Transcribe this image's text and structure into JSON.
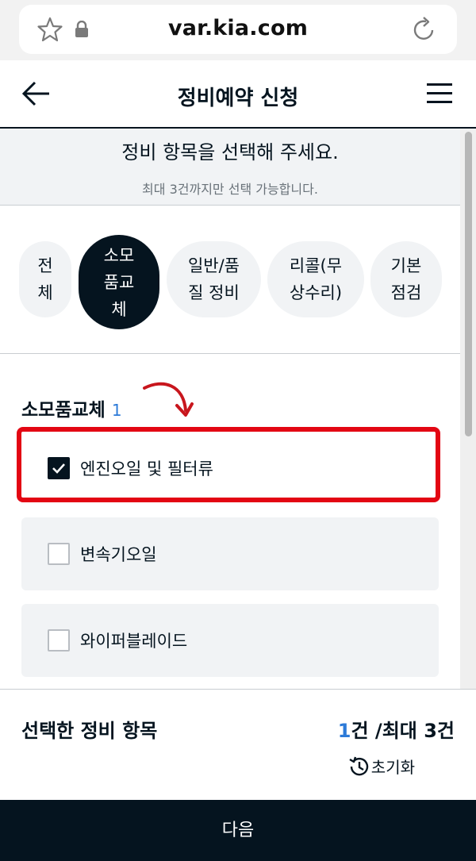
{
  "browser": {
    "url": "var.kia.com",
    "icons": [
      "star-icon",
      "lock-icon",
      "reload-icon"
    ]
  },
  "header": {
    "title": "정비예약 신청",
    "icons": [
      "back-arrow-icon",
      "hamburger-menu-icon"
    ]
  },
  "instruction": {
    "title": "정비 항목을 선택해 주세요.",
    "subtitle": "최대 3건까지만 선택 가능합니다."
  },
  "categories": [
    {
      "label": "전\n체",
      "active": false
    },
    {
      "label": "소모\n품교\n체",
      "active": true
    },
    {
      "label": "일반/품\n질 정비",
      "active": false
    },
    {
      "label": "리콜(무\n상수리)",
      "active": false
    },
    {
      "label": "기본\n점검",
      "active": false
    }
  ],
  "section": {
    "title": "소모품교체",
    "count": "1"
  },
  "options": [
    {
      "label": "엔진오일 및 필터류",
      "checked": true
    },
    {
      "label": "변속기오일",
      "checked": false
    },
    {
      "label": "와이퍼블레이드",
      "checked": false
    }
  ],
  "footer": {
    "title": "선택한 정비 항목",
    "selected_count": "1",
    "count_suffix": "건 /최대 3건",
    "reset_label": "초기화"
  },
  "next_button": {
    "label": "다음"
  },
  "colors": {
    "brand_dark": "#05141f",
    "accent_blue": "#2c7ad8",
    "highlight_red": "#e30613",
    "panel_gray": "#f1f3f5"
  }
}
